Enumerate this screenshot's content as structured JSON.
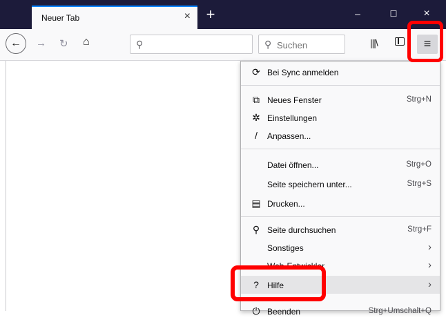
{
  "tab": {
    "title": "Neuer Tab",
    "close": "×"
  },
  "newtab_label": "+",
  "window": {
    "minimize": "–",
    "maximize": "☐",
    "close": "×"
  },
  "toolbar": {
    "search_placeholder": "Suchen"
  },
  "menu": {
    "sync": "Bei Sync anmelden",
    "new_window": {
      "label": "Neues Fenster",
      "shortcut": "Strg+N"
    },
    "settings": "Einstellungen",
    "customize": "Anpassen...",
    "open_file": {
      "label": "Datei öffnen...",
      "shortcut": "Strg+O"
    },
    "save_page": {
      "label": "Seite speichern unter...",
      "shortcut": "Strg+S"
    },
    "print": "Drucken...",
    "find": {
      "label": "Seite durchsuchen",
      "shortcut": "Strg+F"
    },
    "more": {
      "label": "Sonstiges",
      "arrow": "›"
    },
    "webdev": {
      "label": "Web-Entwickler",
      "arrow": "›"
    },
    "help": {
      "label": "Hilfe",
      "arrow": "›"
    },
    "quit": {
      "label": "Beenden",
      "shortcut": "Strg+Umschalt+Q"
    }
  }
}
